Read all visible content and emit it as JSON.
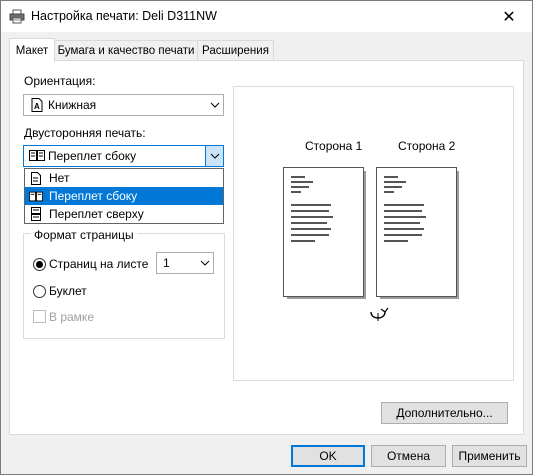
{
  "window": {
    "title": "Настройка печати: Deli D311NW",
    "close_label": "✕"
  },
  "tabs": [
    {
      "label": "Макет",
      "active": true
    },
    {
      "label": "Бумага и качество печати",
      "active": false
    },
    {
      "label": "Расширения",
      "active": false
    }
  ],
  "orientation": {
    "label": "Ориентация:",
    "value": "Книжная"
  },
  "duplex": {
    "label": "Двусторонняя печать:",
    "value": "Переплет сбоку",
    "options": [
      "Нет",
      "Переплет сбоку",
      "Переплет сверху"
    ],
    "selected_index": 1
  },
  "page_format": {
    "title": "Формат страницы",
    "pages_per_sheet_label": "Страниц на листе",
    "pages_per_sheet_value": "1",
    "booklet_label": "Буклет",
    "border_label": "В рамке",
    "pages_per_sheet_checked": true,
    "booklet_checked": false,
    "border_checked": false
  },
  "preview": {
    "side1_label": "Сторона 1",
    "side2_label": "Сторона 2"
  },
  "buttons": {
    "advanced": "Дополнительно...",
    "ok": "OK",
    "cancel": "Отмена",
    "apply": "Применить"
  },
  "colors": {
    "accent": "#0078d7",
    "dialog_bg": "#f0f0f0",
    "selection_bg": "#0078d7",
    "button_bg": "#e1e1e1"
  }
}
